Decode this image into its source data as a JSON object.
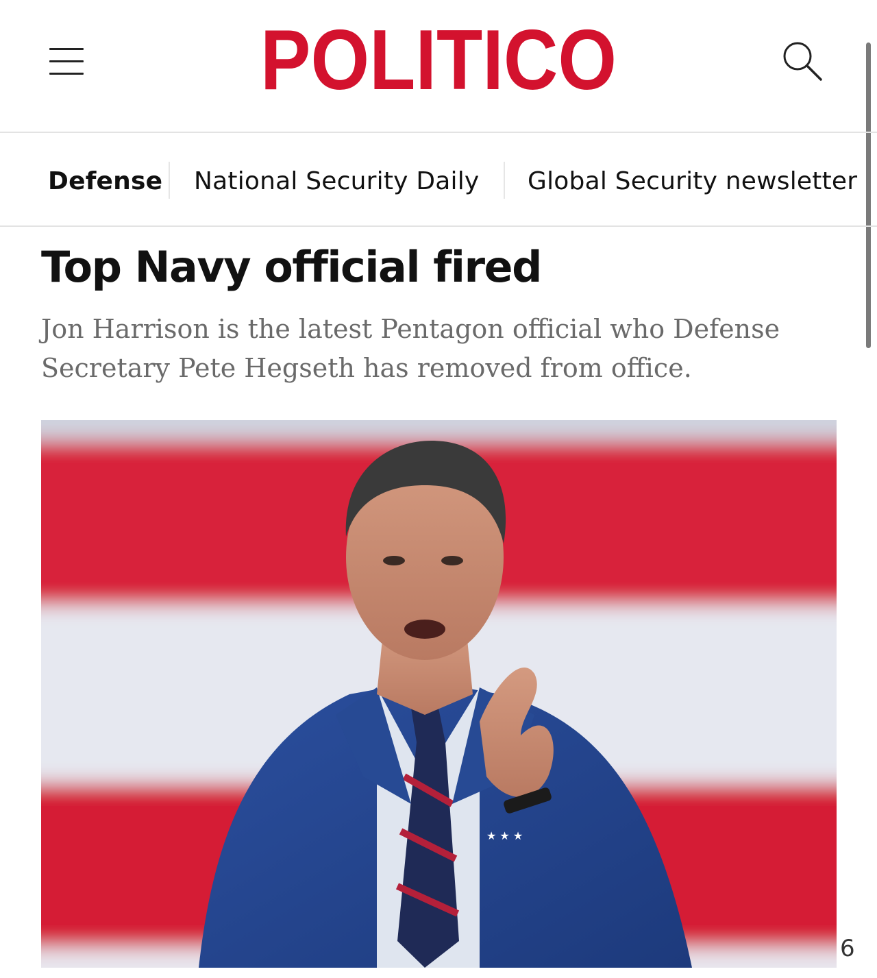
{
  "header": {
    "logo_text": "POLITICO",
    "brand_color": "#d3122e",
    "menu_icon": "hamburger-menu-icon",
    "search_icon": "search-icon"
  },
  "subnav": {
    "items": [
      {
        "label": "Defense",
        "active": true
      },
      {
        "label": "National Security Daily",
        "active": false
      },
      {
        "label": "Global Security newsletter",
        "active": false
      }
    ]
  },
  "article": {
    "headline": "Top Navy official fired",
    "dek": "Jon Harrison is the latest Pentagon official who Defense Secretary Pete Hegseth has removed from office."
  },
  "image": {
    "subject": "man-in-blue-suit-speaking-icon"
  },
  "watermark": {
    "trailing_char": "6"
  }
}
